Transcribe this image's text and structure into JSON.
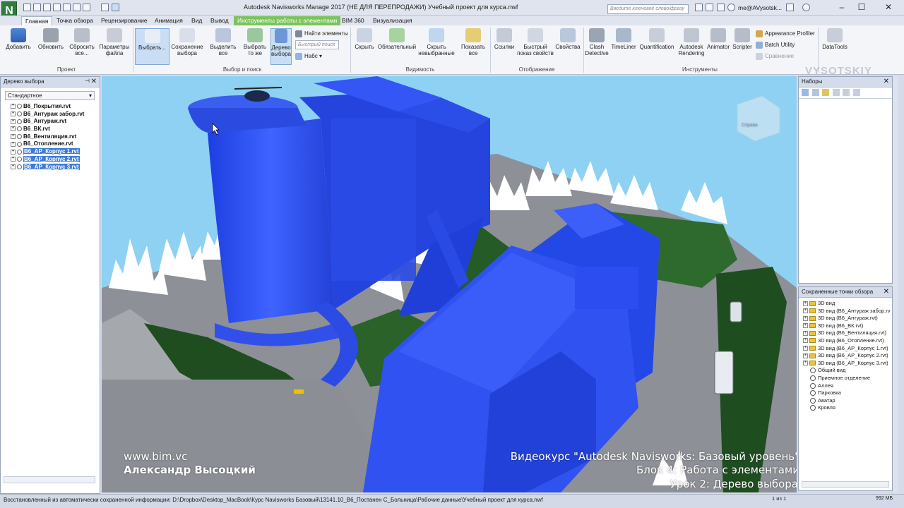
{
  "app": {
    "logo": "N",
    "title": "Autodesk Navisworks Manage 2017 (НЕ ДЛЯ ПЕРЕПРОДАЖИ)   Учебный проект для курса.nwf",
    "search_placeholder": "Введите ключевое слово/фразу",
    "user": "me@AVysotsk..."
  },
  "tabs": [
    "Главная",
    "Точка обзора",
    "Рецензирование",
    "Анимация",
    "Вид",
    "Вывод",
    "Инструменты работы с элементами",
    "BIM 360",
    "Визуализация"
  ],
  "ribbon": {
    "project": {
      "add": "Добавить",
      "refresh": "Обновить",
      "reset": "Сбросить все...",
      "file_options": "Параметры файла",
      "group": "Проект"
    },
    "select": {
      "select": "Выбрать...",
      "save_selection": "Сохранение выбора",
      "select_all": "Выделить все",
      "select_same": "Выбрать то же",
      "selection_tree": "Дерево выбора",
      "find_items": "Найти элементы",
      "quick_find": "Быстрый поиск",
      "sets": "Набс",
      "group": "Выбор и поиск"
    },
    "visibility": {
      "hide": "Скрыть",
      "required": "Обязательный",
      "hide_unselected": "Скрыть невыбранные",
      "show_all": "Показать все",
      "group": "Видимость"
    },
    "display": {
      "links": "Ссылки",
      "quick_props": "Быстрый показ свойств",
      "properties": "Свойства",
      "group": "Отображение"
    },
    "tools": {
      "clash": "Clash Detective",
      "timeliner": "TimeLiner",
      "quantification": "Quantification",
      "rendering": "Autodesk Rendering",
      "animator": "Animator",
      "scripter": "Scripter",
      "appearance": "Appearance Profiler",
      "batch": "Batch Utility",
      "compare": "Сравнение",
      "datatools": "DataTools",
      "group": "Инструменты"
    }
  },
  "left_panel": {
    "title": "Дерево выбора",
    "combo": "Стандартное",
    "items": [
      {
        "label": "В6_Покрытия.rvt",
        "selected": false
      },
      {
        "label": "В6_Антураж забор.rvt",
        "selected": false
      },
      {
        "label": "В6_Антураж.rvt",
        "selected": false
      },
      {
        "label": "В6_ВК.rvt",
        "selected": false
      },
      {
        "label": "В6_Вентиляция.rvt",
        "selected": false
      },
      {
        "label": "В6_Отопление.rvt",
        "selected": false
      },
      {
        "label": "В6_АР_Корпус 1.rvt",
        "selected": true
      },
      {
        "label": "В6_АР_Корпус 2.rvt",
        "selected": true
      },
      {
        "label": "В6_АР_Корпус 3.rvt",
        "selected": true
      }
    ]
  },
  "sets_panel": {
    "title": "Наборы"
  },
  "viewpoints_panel": {
    "title": "Сохраненные точки обзора",
    "folders": [
      "3D вид",
      "3D вид (В6_Антураж забор.rv",
      "3D вид (В6_Антураж.rvt)",
      "3D вид (В6_ВК.rvt)",
      "3D вид (В6_Вентиляция.rvt)",
      "3D вид (В6_Отопление.rvt)",
      "3D вид (В6_АР_Корпус 1.rvt)",
      "3D вид (В6_АР_Корпус 2.rvt)",
      "3D вид (В6_АР_Корпус 3.rvt)"
    ],
    "views": [
      "Общий вид",
      "Приемное отделение",
      "Аллея",
      "Парковка",
      "Аватар",
      "Кровля"
    ]
  },
  "overlay": {
    "site": "www.bim.vc",
    "author": "Александр Высоцкий",
    "course": "Видеокурс \"Autodesk Navisworks: Базовый уровень\"",
    "block": "Блок 4: Работа с элементами",
    "lesson": "Урок 2: Дерево выбора",
    "watermark": "VYSOTSKIY",
    "viewcube": "Справа"
  },
  "status": {
    "path": "Восстановленный из автоматически сохраненной информации: D:\\Dropbox\\Desktop_MacBook\\Курс Navisworks Базовый\\13141.10_В6_Постанен С_Больница\\Рабочие данные\\Учебный проект для курса.nwf",
    "pager": "1 из 1",
    "memory": "992 МБ"
  },
  "colors": {
    "accent": "#2f5fd6",
    "building": "#2a48e8",
    "context_tab": "#7cc35e",
    "sky": "#8ed1f2"
  }
}
